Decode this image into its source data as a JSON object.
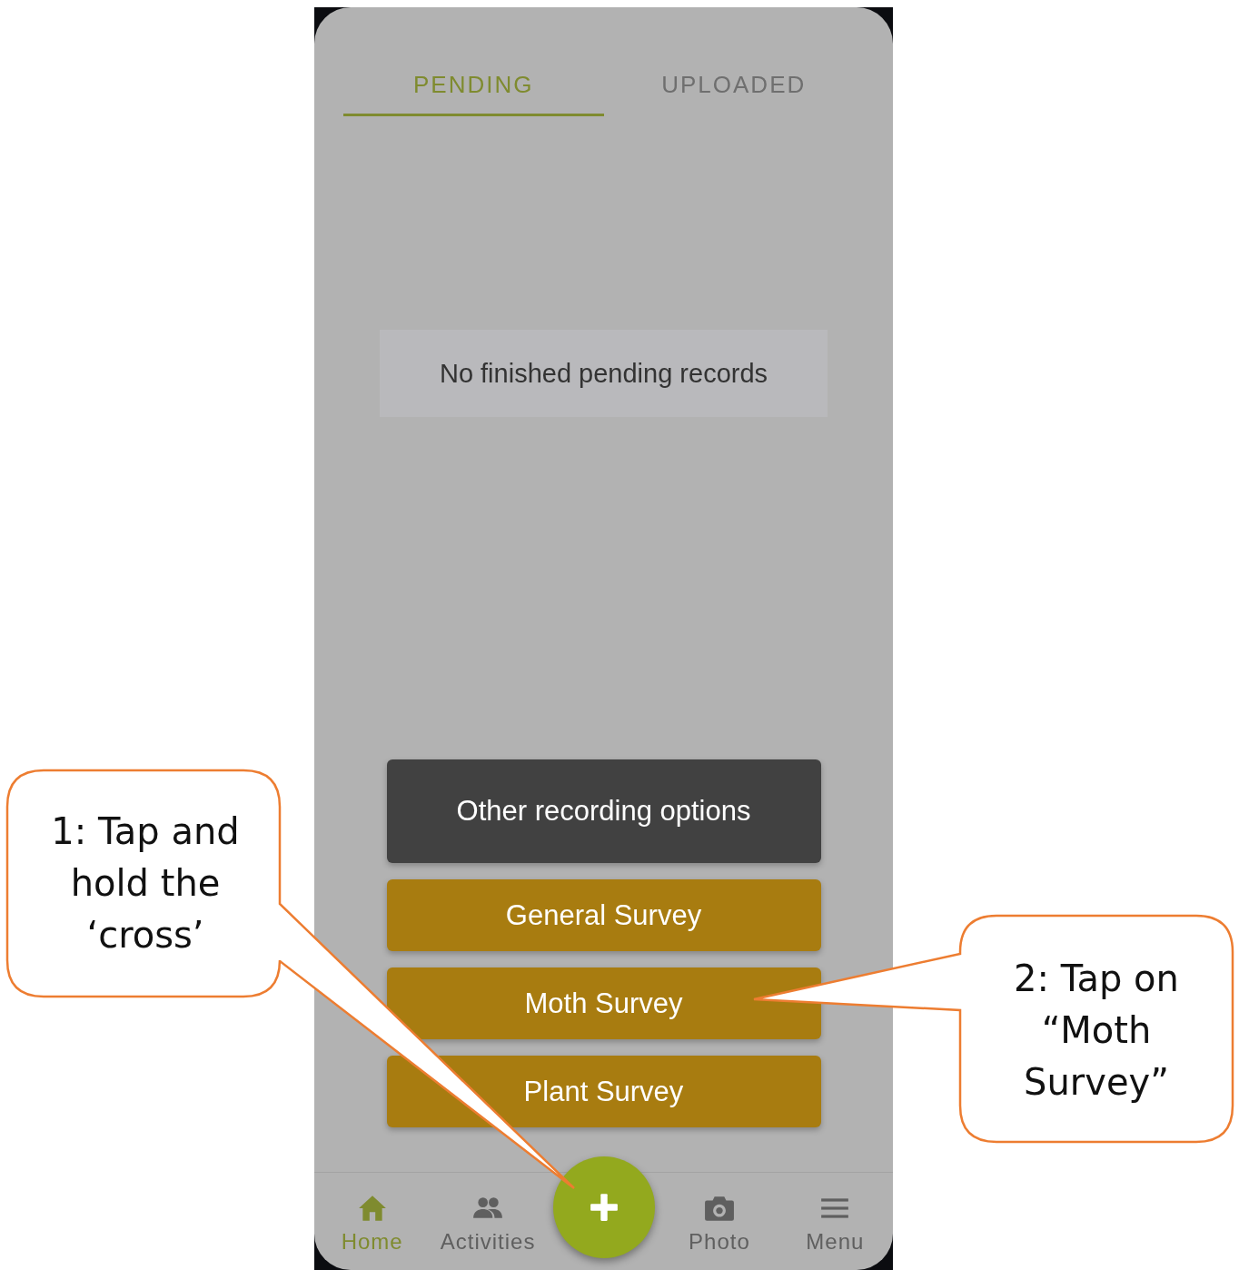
{
  "tabs": [
    {
      "label": "PENDING",
      "selected": true
    },
    {
      "label": "UPLOADED",
      "selected": false
    }
  ],
  "empty_message": "No finished pending records",
  "record_options": [
    {
      "label": "Other recording options",
      "kind": "secondary"
    },
    {
      "label": "General Survey",
      "kind": "survey"
    },
    {
      "label": "Moth Survey",
      "kind": "survey"
    },
    {
      "label": "Plant Survey",
      "kind": "survey"
    }
  ],
  "bottom_nav": [
    {
      "kind": "item",
      "label": "Home",
      "selected": true
    },
    {
      "kind": "item",
      "label": "Activities",
      "selected": false
    },
    {
      "kind": "fab"
    },
    {
      "kind": "item",
      "label": "Photo",
      "selected": false
    },
    {
      "kind": "item",
      "label": "Menu",
      "selected": false
    }
  ],
  "callouts": [
    {
      "text": "1: Tap and hold the ‘cross’"
    },
    {
      "text": "2: Tap on “Moth Survey”"
    }
  ]
}
